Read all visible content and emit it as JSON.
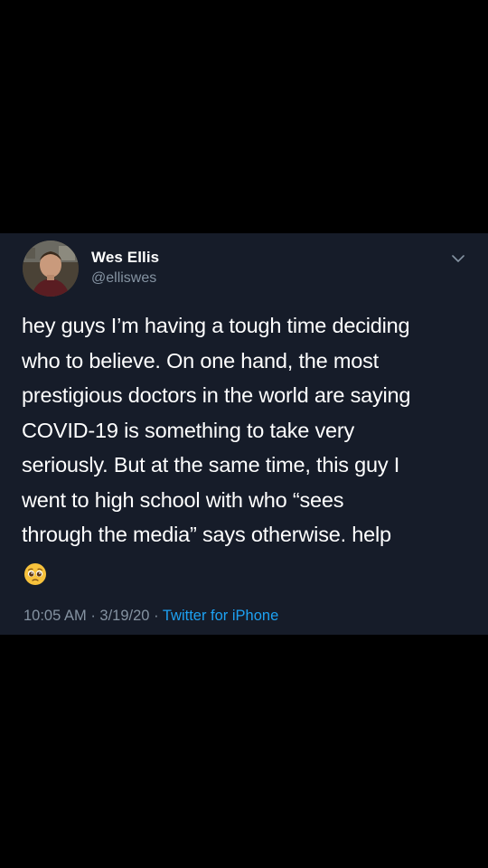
{
  "tweet": {
    "author": {
      "name": "Wes Ellis",
      "handle": "@elliswes"
    },
    "text_lines": [
      "hey guys I’m having a tough time deciding",
      "who to believe. On one hand, the most",
      "prestigious doctors in the world are saying",
      "COVID-19 is something to take very",
      "seriously. But at the same time, this guy I",
      "went to high school with who “sees",
      "through the media” says otherwise. help"
    ],
    "emoji": "pleading-face-emoji",
    "meta": {
      "time": "10:05 AM",
      "separator": "·",
      "date": "3/19/20",
      "source": "Twitter for iPhone"
    },
    "icons": {
      "more_menu": "chevron-down-icon"
    }
  },
  "colors": {
    "page_background": "#000000",
    "card_background": "#161c29",
    "text_primary": "#ffffff",
    "text_secondary": "#8593a2",
    "link": "#1da1f2"
  }
}
